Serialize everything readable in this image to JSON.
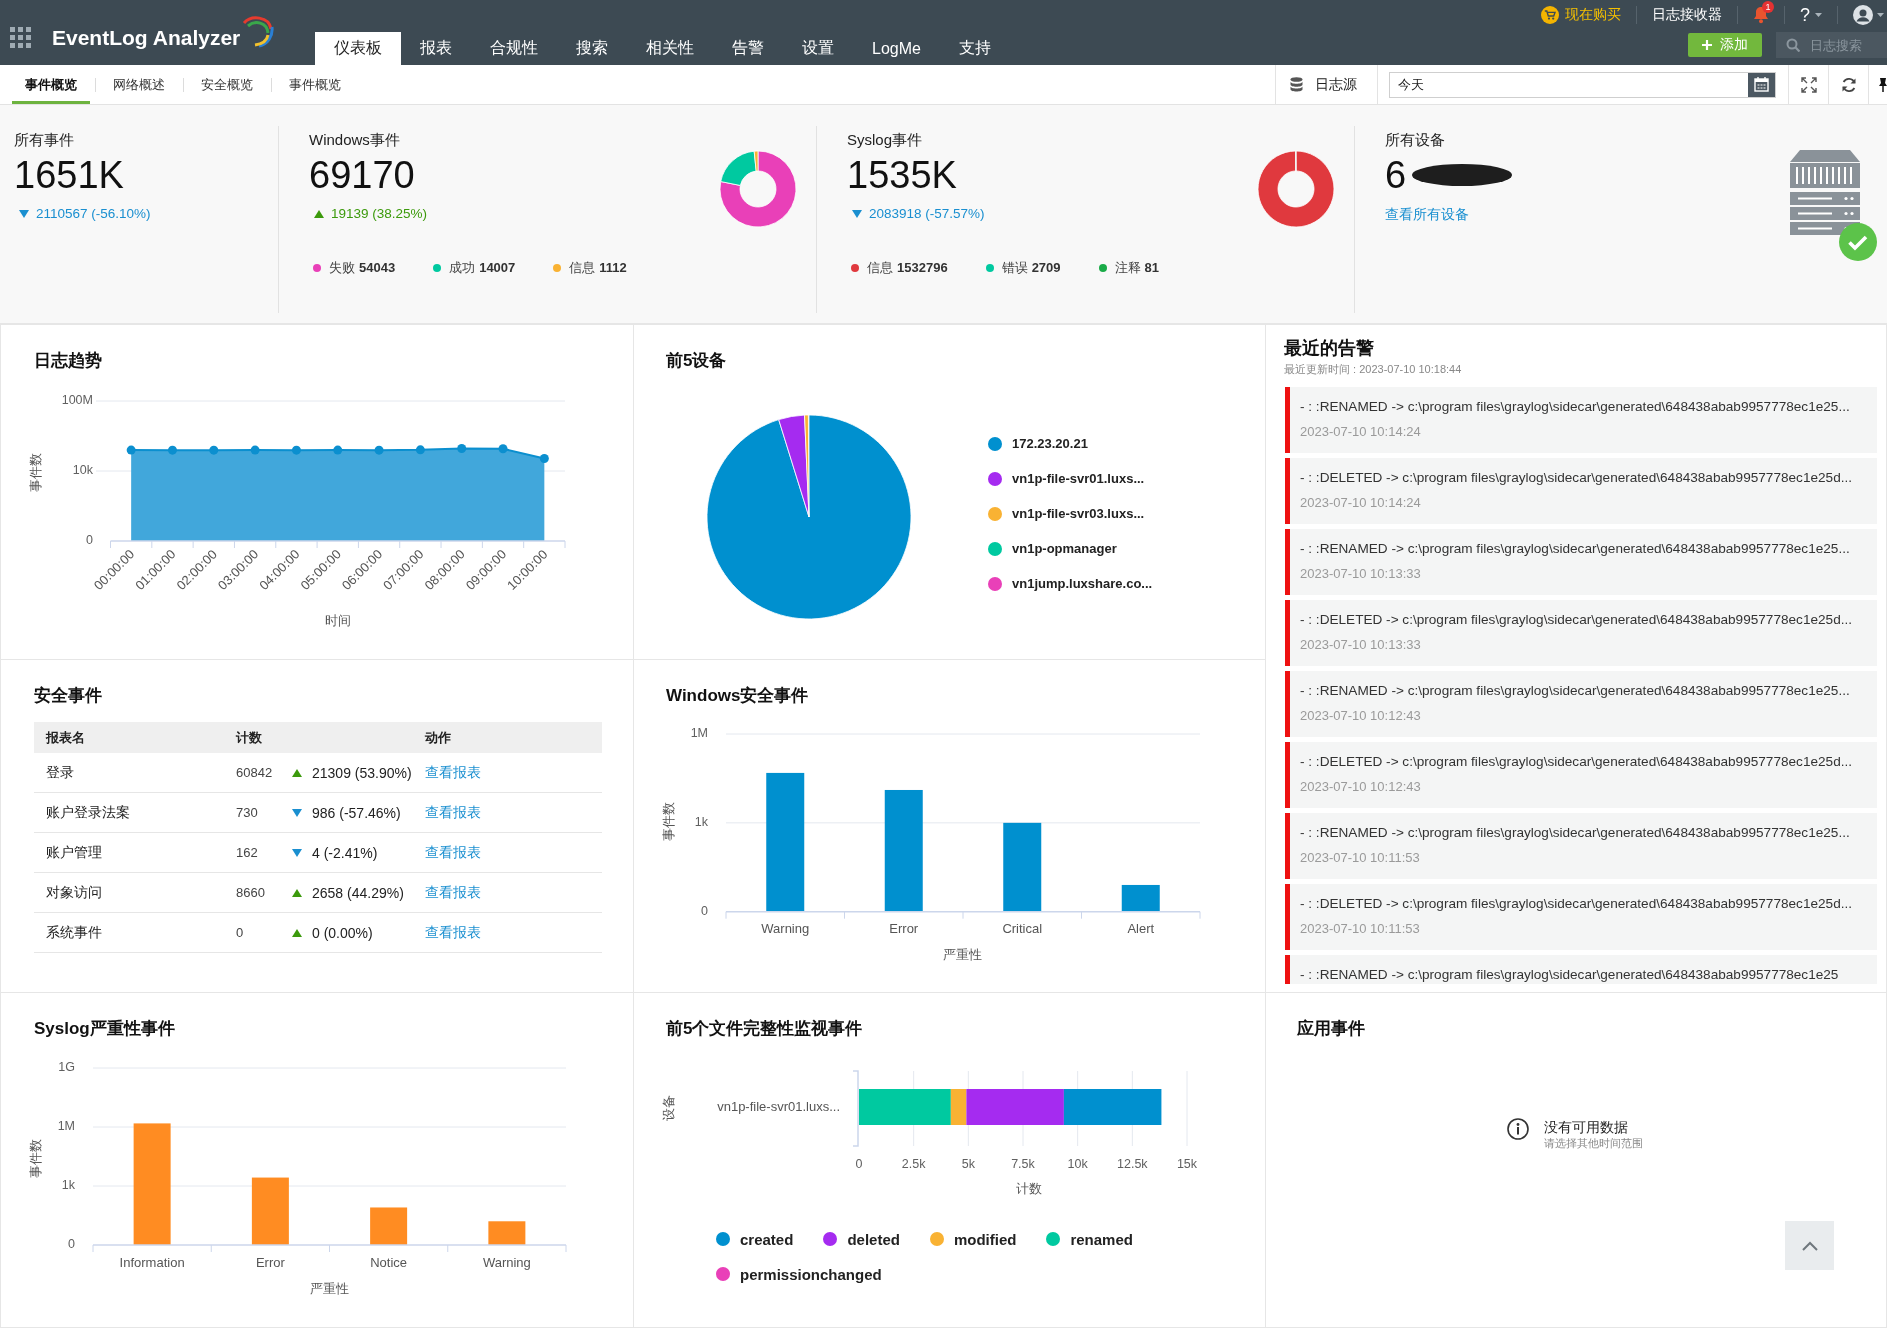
{
  "header": {
    "logo": "EventLog Analyzer",
    "nav": [
      {
        "label": "仪表板",
        "selected": true
      },
      {
        "label": "报表",
        "selected": false
      },
      {
        "label": "合规性",
        "selected": false
      },
      {
        "label": "搜索",
        "selected": false
      },
      {
        "label": "相关性",
        "selected": false
      },
      {
        "label": "告警",
        "selected": false
      },
      {
        "label": "设置",
        "selected": false
      },
      {
        "label": "LogMe",
        "selected": false
      },
      {
        "label": "支持",
        "selected": false
      }
    ],
    "buy_now": "现在购买",
    "log_receiver": "日志接收器",
    "notification_count": "1",
    "help": "?",
    "add_button": "添加",
    "search": {
      "placeholder": "日志搜索"
    }
  },
  "subnav": {
    "tabs": [
      {
        "label": "事件概览",
        "selected": true
      },
      {
        "label": "网络概述",
        "selected": false
      },
      {
        "label": "安全概览",
        "selected": false
      },
      {
        "label": "事件概览",
        "selected": false
      }
    ],
    "log_source": "日志源",
    "date_field": {
      "value": "今天"
    }
  },
  "summary": [
    {
      "kind": "plain",
      "label": "所有事件",
      "value": "1651K",
      "change": {
        "kind": "down",
        "text": "2110567 (-56.10%)"
      }
    },
    {
      "kind": "donut",
      "label": "Windows事件",
      "value": "69170",
      "change": {
        "kind": "up",
        "text": "19139 (38.25%)"
      },
      "chart_data": {
        "type": "donut",
        "values": [
          78.14,
          20.25,
          1.61
        ]
      },
      "legend": [
        {
          "label": "失败",
          "value": "54043",
          "color": "#e940b8"
        },
        {
          "label": "成功",
          "value": "14007",
          "color": "#00c9a0"
        },
        {
          "label": "信息",
          "value": "1112",
          "color": "#f9b233"
        }
      ]
    },
    {
      "kind": "donut",
      "label": "Syslog事件",
      "value": "1535K",
      "change": {
        "kind": "down",
        "text": "2083918 (-57.57%)"
      },
      "chart_data": {
        "type": "donut",
        "values": [
          99.82,
          0.18
        ]
      },
      "legend": [
        {
          "label": "信息",
          "value": "1532796",
          "color": "#e0393e"
        },
        {
          "label": "错误",
          "value": "2709",
          "color": "#00c9a0"
        },
        {
          "label": "注释",
          "value": "81",
          "color": "#1aab48"
        }
      ]
    },
    {
      "kind": "devices",
      "label": "所有设备",
      "value": "6",
      "link": "查看所有设备"
    }
  ],
  "log_trend": {
    "title": "日志趋势",
    "y_axis": {
      "title": "事件数",
      "tick_labels": [
        "100M",
        "10k",
        "0"
      ]
    },
    "x_axis": {
      "title": "时间",
      "tick_labels": [
        "00:00:00",
        "01:00:00",
        "02:00:00",
        "03:00:00",
        "04:00:00",
        "05:00:00",
        "06:00:00",
        "07:00:00",
        "08:00:00",
        "09:00:00",
        "10:00:00"
      ]
    }
  },
  "top_devices": {
    "title": "前5设备",
    "legend": [
      {
        "label": "172.23.20.21",
        "color": "#0090cf"
      },
      {
        "label": "vn1p-file-svr01.luxs...",
        "color": "#a52bf0"
      },
      {
        "label": "vn1p-file-svr03.luxs...",
        "color": "#f9b233"
      },
      {
        "label": "vn1p-opmanager",
        "color": "#00c9a0"
      },
      {
        "label": "vn1jump.luxshare.co...",
        "color": "#e940b8"
      }
    ]
  },
  "recent_alerts": {
    "title": "最近的告警",
    "updated": "最近更新时间 : 2023-07-10 10:18:44",
    "items": [
      {
        "message": "- : :RENAMED -> c:\\program files\\graylog\\sidecar\\generated\\648438abab9957778ec1e25...",
        "time": "2023-07-10 10:14:24"
      },
      {
        "message": "- : :DELETED -> c:\\program files\\graylog\\sidecar\\generated\\648438abab9957778ec1e25d...",
        "time": "2023-07-10 10:14:24"
      },
      {
        "message": "- : :RENAMED -> c:\\program files\\graylog\\sidecar\\generated\\648438abab9957778ec1e25...",
        "time": "2023-07-10 10:13:33"
      },
      {
        "message": "- : :DELETED -> c:\\program files\\graylog\\sidecar\\generated\\648438abab9957778ec1e25d...",
        "time": "2023-07-10 10:13:33"
      },
      {
        "message": "- : :RENAMED -> c:\\program files\\graylog\\sidecar\\generated\\648438abab9957778ec1e25...",
        "time": "2023-07-10 10:12:43"
      },
      {
        "message": "- : :DELETED -> c:\\program files\\graylog\\sidecar\\generated\\648438abab9957778ec1e25d...",
        "time": "2023-07-10 10:12:43"
      },
      {
        "message": "- : :RENAMED -> c:\\program files\\graylog\\sidecar\\generated\\648438abab9957778ec1e25...",
        "time": "2023-07-10 10:11:53"
      },
      {
        "message": "- : :DELETED -> c:\\program files\\graylog\\sidecar\\generated\\648438abab9957778ec1e25d...",
        "time": "2023-07-10 10:11:53"
      },
      {
        "message": "- : :RENAMED -> c:\\program files\\graylog\\sidecar\\generated\\648438abab9957778ec1e25"
      }
    ]
  },
  "security_events": {
    "title": "安全事件",
    "columns": [
      "报表名",
      "计数",
      "动作"
    ],
    "rows": [
      {
        "name": "登录",
        "count": "60842",
        "kind": "up",
        "change": "21309 (53.90%)",
        "action": "查看报表"
      },
      {
        "name": "账户登录法案",
        "count": "730",
        "kind": "down",
        "change": "986 (-57.46%)",
        "action": "查看报表"
      },
      {
        "name": "账户管理",
        "count": "162",
        "kind": "down",
        "change": "4 (-2.41%)",
        "action": "查看报表"
      },
      {
        "name": "对象访问",
        "count": "8660",
        "kind": "up",
        "change": "2658 (44.29%)",
        "action": "查看报表"
      },
      {
        "name": "系统事件",
        "count": "0",
        "kind": "up",
        "change": "0 (0.00%)",
        "action": "查看报表"
      }
    ]
  },
  "windows_security_events": {
    "title": "Windows安全事件",
    "y_axis": {
      "title": "事件数",
      "tick_labels": [
        "1M",
        "1k",
        "0"
      ]
    },
    "x_axis": {
      "title": "严重性",
      "tick_labels": [
        "Warning",
        "Error",
        "Critical",
        "Alert"
      ]
    }
  },
  "syslog_severity_events": {
    "title": "Syslog严重性事件",
    "y_axis": {
      "title": "事件数",
      "tick_labels": [
        "1G",
        "1M",
        "1k",
        "0"
      ]
    },
    "x_axis": {
      "title": "严重性",
      "tick_labels": [
        "Information",
        "Error",
        "Notice",
        "Warning"
      ]
    }
  },
  "fim_events": {
    "title": "前5个文件完整性监视事件",
    "chart_data": {
      "type": "bar",
      "orientation": "horizontal",
      "stacked": true,
      "xlabel": "计数",
      "ylabel": "设备",
      "categories": [
        "vn1p-file-svr01.luxs..."
      ],
      "series": [
        {
          "name": "created",
          "color": "#0090cf",
          "values": [
            4460
          ]
        },
        {
          "name": "deleted",
          "color": "#a52bf0",
          "values": [
            4460
          ]
        },
        {
          "name": "modified",
          "color": "#f9b233",
          "values": [
            710
          ]
        },
        {
          "name": "renamed",
          "color": "#00c9a0",
          "values": [
            4200
          ]
        },
        {
          "name": "permissionchanged",
          "color": "#e940b8",
          "values": [
            0
          ]
        }
      ],
      "xlim": [
        0,
        15000
      ],
      "xticks": [
        {
          "value": 0,
          "label": "0"
        },
        {
          "value": 2500,
          "label": "2.5k"
        },
        {
          "value": 5000,
          "label": "5k"
        },
        {
          "value": 7500,
          "label": "7.5k"
        },
        {
          "value": 10000,
          "label": "10k"
        },
        {
          "value": 12500,
          "label": "12.5k"
        },
        {
          "value": 15000,
          "label": "15k"
        }
      ],
      "grid": true
    }
  },
  "app_events": {
    "title": "应用事件",
    "empty_title": "没有可用数据",
    "empty_hint": "请选择其他时间范围"
  }
}
